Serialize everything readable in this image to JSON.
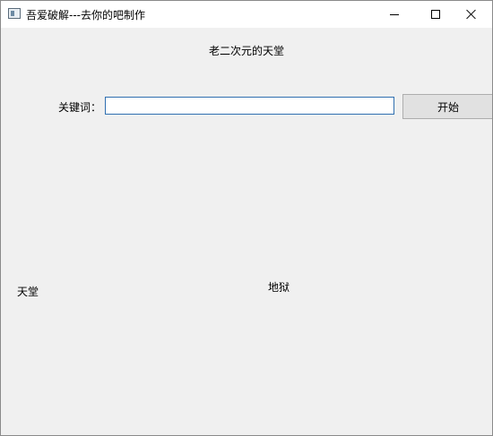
{
  "window": {
    "title": "吾爱破解---去你的吧制作"
  },
  "main": {
    "header": "老二次元的天堂",
    "keyword_label": "关键词：",
    "keyword_value": "",
    "start_label": "开始",
    "heaven_label": "天堂",
    "hell_label": "地狱"
  }
}
